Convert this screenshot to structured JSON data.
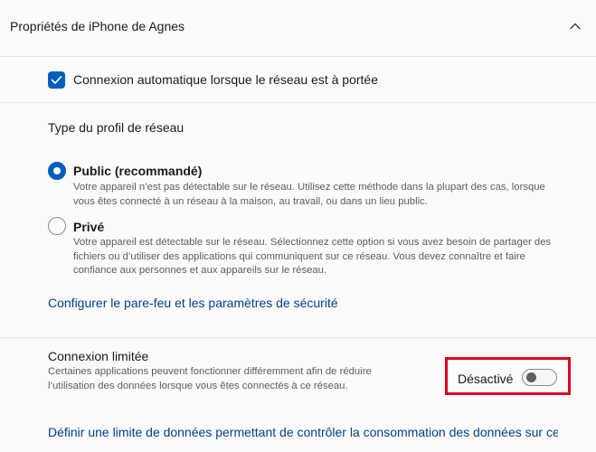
{
  "header": {
    "title": "Propriétés de iPhone de Agnes",
    "collapse_icon": "chevron-up-icon"
  },
  "auto_connect": {
    "checked": true,
    "label": "Connexion automatique lorsque le réseau est à portée"
  },
  "network_profile": {
    "heading": "Type du profil de réseau",
    "options": [
      {
        "title": "Public (recommandé)",
        "selected": true,
        "description": "Votre appareil n’est pas détectable sur le réseau. Utilisez cette méthode dans la plupart des cas, lorsque vous êtes connecté à un réseau à la maison, au travail, ou dans un lieu public."
      },
      {
        "title": "Privé",
        "selected": false,
        "description": "Votre appareil est détectable sur le réseau. Sélectionnez cette option si vous avez besoin de partager des fichiers ou d’utiliser des applications qui communiquent sur ce réseau. Vous devez connaître et faire confiance aux personnes et aux appareils sur le réseau."
      }
    ],
    "firewall_link": "Configurer le pare-feu et les paramètres de sécurité"
  },
  "metered": {
    "title": "Connexion limitée",
    "description": "Certaines applications peuvent fonctionner différemment afin de réduire l’utilisation des données lorsque vous êtes connectés à ce réseau.",
    "toggle_label": "Désactivé",
    "toggle_on": false,
    "data_limit_link": "Définir une limite de données permettant de contrôler la consommation des données sur ce réseau"
  },
  "colors": {
    "accent": "#005fb8",
    "link": "#003e92",
    "highlight": "#e0001b"
  }
}
